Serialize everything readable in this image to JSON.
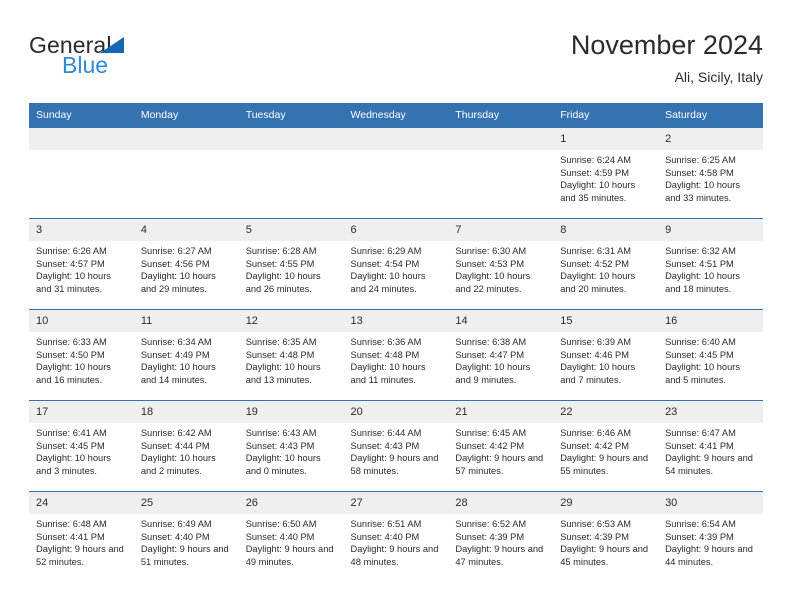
{
  "brand": {
    "name_primary": "General",
    "name_secondary": "Blue",
    "triangle_color": "#1268b3",
    "secondary_color": "#2e8ad6"
  },
  "header": {
    "title": "November 2024",
    "subtitle": "Ali, Sicily, Italy"
  },
  "theme": {
    "header_bar_color": "#3572b0",
    "daynum_band_color": "#efefef",
    "text_color": "#2b2b2b"
  },
  "weekday_headers": [
    "Sunday",
    "Monday",
    "Tuesday",
    "Wednesday",
    "Thursday",
    "Friday",
    "Saturday"
  ],
  "labels": {
    "sunrise_prefix": "Sunrise:",
    "sunset_prefix": "Sunset:",
    "daylight_prefix": "Daylight:"
  },
  "weeks": [
    [
      {
        "day": "",
        "empty": true
      },
      {
        "day": "",
        "empty": true
      },
      {
        "day": "",
        "empty": true
      },
      {
        "day": "",
        "empty": true
      },
      {
        "day": "",
        "empty": true
      },
      {
        "day": "1",
        "sunrise": "Sunrise: 6:24 AM",
        "sunset": "Sunset: 4:59 PM",
        "daylight": "Daylight: 10 hours and 35 minutes."
      },
      {
        "day": "2",
        "sunrise": "Sunrise: 6:25 AM",
        "sunset": "Sunset: 4:58 PM",
        "daylight": "Daylight: 10 hours and 33 minutes."
      }
    ],
    [
      {
        "day": "3",
        "sunrise": "Sunrise: 6:26 AM",
        "sunset": "Sunset: 4:57 PM",
        "daylight": "Daylight: 10 hours and 31 minutes."
      },
      {
        "day": "4",
        "sunrise": "Sunrise: 6:27 AM",
        "sunset": "Sunset: 4:56 PM",
        "daylight": "Daylight: 10 hours and 29 minutes."
      },
      {
        "day": "5",
        "sunrise": "Sunrise: 6:28 AM",
        "sunset": "Sunset: 4:55 PM",
        "daylight": "Daylight: 10 hours and 26 minutes."
      },
      {
        "day": "6",
        "sunrise": "Sunrise: 6:29 AM",
        "sunset": "Sunset: 4:54 PM",
        "daylight": "Daylight: 10 hours and 24 minutes."
      },
      {
        "day": "7",
        "sunrise": "Sunrise: 6:30 AM",
        "sunset": "Sunset: 4:53 PM",
        "daylight": "Daylight: 10 hours and 22 minutes."
      },
      {
        "day": "8",
        "sunrise": "Sunrise: 6:31 AM",
        "sunset": "Sunset: 4:52 PM",
        "daylight": "Daylight: 10 hours and 20 minutes."
      },
      {
        "day": "9",
        "sunrise": "Sunrise: 6:32 AM",
        "sunset": "Sunset: 4:51 PM",
        "daylight": "Daylight: 10 hours and 18 minutes."
      }
    ],
    [
      {
        "day": "10",
        "sunrise": "Sunrise: 6:33 AM",
        "sunset": "Sunset: 4:50 PM",
        "daylight": "Daylight: 10 hours and 16 minutes."
      },
      {
        "day": "11",
        "sunrise": "Sunrise: 6:34 AM",
        "sunset": "Sunset: 4:49 PM",
        "daylight": "Daylight: 10 hours and 14 minutes."
      },
      {
        "day": "12",
        "sunrise": "Sunrise: 6:35 AM",
        "sunset": "Sunset: 4:48 PM",
        "daylight": "Daylight: 10 hours and 13 minutes."
      },
      {
        "day": "13",
        "sunrise": "Sunrise: 6:36 AM",
        "sunset": "Sunset: 4:48 PM",
        "daylight": "Daylight: 10 hours and 11 minutes."
      },
      {
        "day": "14",
        "sunrise": "Sunrise: 6:38 AM",
        "sunset": "Sunset: 4:47 PM",
        "daylight": "Daylight: 10 hours and 9 minutes."
      },
      {
        "day": "15",
        "sunrise": "Sunrise: 6:39 AM",
        "sunset": "Sunset: 4:46 PM",
        "daylight": "Daylight: 10 hours and 7 minutes."
      },
      {
        "day": "16",
        "sunrise": "Sunrise: 6:40 AM",
        "sunset": "Sunset: 4:45 PM",
        "daylight": "Daylight: 10 hours and 5 minutes."
      }
    ],
    [
      {
        "day": "17",
        "sunrise": "Sunrise: 6:41 AM",
        "sunset": "Sunset: 4:45 PM",
        "daylight": "Daylight: 10 hours and 3 minutes."
      },
      {
        "day": "18",
        "sunrise": "Sunrise: 6:42 AM",
        "sunset": "Sunset: 4:44 PM",
        "daylight": "Daylight: 10 hours and 2 minutes."
      },
      {
        "day": "19",
        "sunrise": "Sunrise: 6:43 AM",
        "sunset": "Sunset: 4:43 PM",
        "daylight": "Daylight: 10 hours and 0 minutes."
      },
      {
        "day": "20",
        "sunrise": "Sunrise: 6:44 AM",
        "sunset": "Sunset: 4:43 PM",
        "daylight": "Daylight: 9 hours and 58 minutes."
      },
      {
        "day": "21",
        "sunrise": "Sunrise: 6:45 AM",
        "sunset": "Sunset: 4:42 PM",
        "daylight": "Daylight: 9 hours and 57 minutes."
      },
      {
        "day": "22",
        "sunrise": "Sunrise: 6:46 AM",
        "sunset": "Sunset: 4:42 PM",
        "daylight": "Daylight: 9 hours and 55 minutes."
      },
      {
        "day": "23",
        "sunrise": "Sunrise: 6:47 AM",
        "sunset": "Sunset: 4:41 PM",
        "daylight": "Daylight: 9 hours and 54 minutes."
      }
    ],
    [
      {
        "day": "24",
        "sunrise": "Sunrise: 6:48 AM",
        "sunset": "Sunset: 4:41 PM",
        "daylight": "Daylight: 9 hours and 52 minutes."
      },
      {
        "day": "25",
        "sunrise": "Sunrise: 6:49 AM",
        "sunset": "Sunset: 4:40 PM",
        "daylight": "Daylight: 9 hours and 51 minutes."
      },
      {
        "day": "26",
        "sunrise": "Sunrise: 6:50 AM",
        "sunset": "Sunset: 4:40 PM",
        "daylight": "Daylight: 9 hours and 49 minutes."
      },
      {
        "day": "27",
        "sunrise": "Sunrise: 6:51 AM",
        "sunset": "Sunset: 4:40 PM",
        "daylight": "Daylight: 9 hours and 48 minutes."
      },
      {
        "day": "28",
        "sunrise": "Sunrise: 6:52 AM",
        "sunset": "Sunset: 4:39 PM",
        "daylight": "Daylight: 9 hours and 47 minutes."
      },
      {
        "day": "29",
        "sunrise": "Sunrise: 6:53 AM",
        "sunset": "Sunset: 4:39 PM",
        "daylight": "Daylight: 9 hours and 45 minutes."
      },
      {
        "day": "30",
        "sunrise": "Sunrise: 6:54 AM",
        "sunset": "Sunset: 4:39 PM",
        "daylight": "Daylight: 9 hours and 44 minutes."
      }
    ]
  ]
}
